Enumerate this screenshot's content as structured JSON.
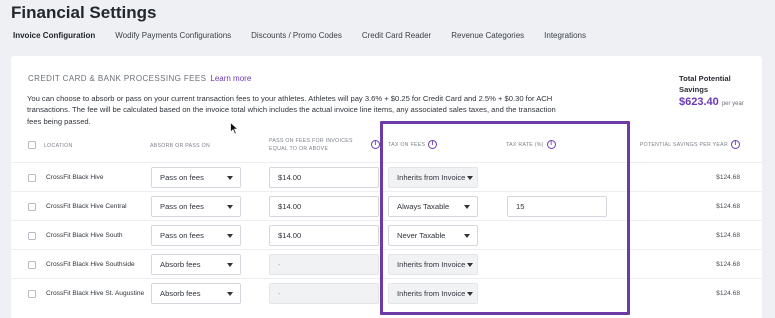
{
  "page": {
    "title": "Financial Settings"
  },
  "tabs": [
    {
      "label": "Invoice Configuration",
      "active": true
    },
    {
      "label": "Wodify Payments Configurations",
      "active": false
    },
    {
      "label": "Discounts / Promo Codes",
      "active": false
    },
    {
      "label": "Credit Card Reader",
      "active": false
    },
    {
      "label": "Revenue Categories",
      "active": false
    },
    {
      "label": "Integrations",
      "active": false
    }
  ],
  "section": {
    "title": "CREDIT CARD & BANK PROCESSING FEES",
    "learn_more": "Learn more",
    "description": "You can choose to absorb or pass on your current transaction fees to your athletes. Athletes will pay 3.6% + $0.25 for Credit Card and 2.5% + $0.30 for ACH transactions. The fee will be calculated based on the invoice total which includes the actual invoice line items, any associated sales taxes, and the transaction fees being passed."
  },
  "savings": {
    "label": "Total Potential Savings",
    "amount": "$623.40",
    "period": "per year"
  },
  "table": {
    "headers": {
      "location": "LOCATION",
      "absorb": "ABSORB OR PASS ON",
      "pass_on": "PASS ON FEES FOR INVOICES EQUAL TO OR ABOVE",
      "tax_on_fees": "TAX ON FEES",
      "tax_rate": "TAX RATE (%)",
      "potential_savings": "POTENTIAL SAVINGS PER YEAR"
    },
    "rows": [
      {
        "location": "CrossFit Black Hive",
        "absorb": "Pass on fees",
        "threshold": "$14.00",
        "tax": "Inherits from Invoice",
        "rate": "",
        "savings": "$124.68"
      },
      {
        "location": "CrossFit Black Hive Central",
        "absorb": "Pass on fees",
        "threshold": "$14.00",
        "tax": "Always Taxable",
        "rate": "15",
        "savings": "$124.68"
      },
      {
        "location": "CrossFit Black Hive South",
        "absorb": "Pass on fees",
        "threshold": "$14.00",
        "tax": "Never Taxable",
        "rate": "",
        "savings": "$124.68"
      },
      {
        "location": "CrossFit Black Hive Southside",
        "absorb": "Absorb fees",
        "threshold": "-",
        "tax": "Inherits from Invoice",
        "rate": "",
        "savings": "$124.68"
      },
      {
        "location": "CrossFit Black Hive St. Augustine",
        "absorb": "Absorb fees",
        "threshold": "-",
        "tax": "Inherits from Invoice",
        "rate": "",
        "savings": "$124.68"
      }
    ]
  },
  "colors": {
    "accent": "#6a3ab5",
    "highlight": "#6d3aa6"
  }
}
